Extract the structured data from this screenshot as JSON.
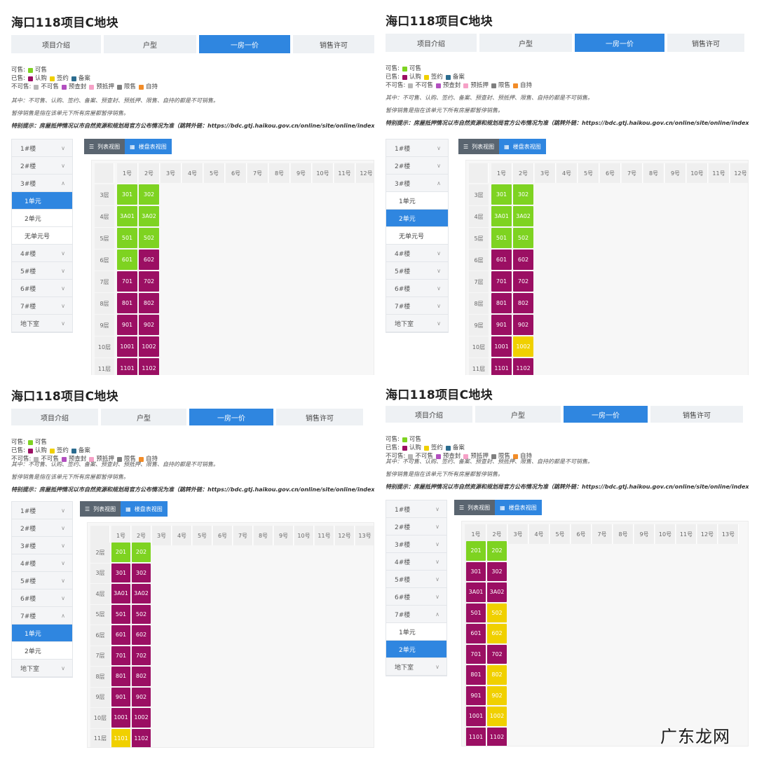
{
  "panels": [
    {
      "title": "海口118项目C地块",
      "tabs": [
        "项目介绍",
        "户型",
        "一房一价",
        "销售许可"
      ],
      "active_tab": 2,
      "legend": {
        "available_label": "可售:",
        "available_items": [
          "可售"
        ],
        "sold_label": "已售:",
        "sold_items": [
          "认购",
          "签约",
          "备案"
        ],
        "unavailable_label": "不可售:",
        "unavailable_items": [
          "不可售",
          "预查封",
          "预抵押",
          "限售",
          "自持"
        ]
      },
      "note1": "其中：不可售、认购、签约、备案、预查封、预抵押、限售、自持的都是不可销售。",
      "note2": "暂停销售是指在该单元下所有房屋都暂停销售。",
      "note3": "特别提示：房屋抵押情况以市自然资源和规划局官方公布情况为准（跳转外链：https://bdc.gtj.haikou.gov.cn/online/site/online/index.htm",
      "sidebar": [
        {
          "label": "1#楼",
          "type": "group",
          "chev": "∨"
        },
        {
          "label": "2#楼",
          "type": "group",
          "chev": "∨"
        },
        {
          "label": "3#楼",
          "type": "group",
          "chev": "∧"
        },
        {
          "label": "1单元",
          "type": "sub",
          "active": true
        },
        {
          "label": "2单元",
          "type": "sub",
          "active": false
        },
        {
          "label": "无单元号",
          "type": "sub",
          "active": false
        },
        {
          "label": "4#楼",
          "type": "group",
          "chev": "∨"
        },
        {
          "label": "5#楼",
          "type": "group",
          "chev": "∨"
        },
        {
          "label": "6#楼",
          "type": "group",
          "chev": "∨"
        },
        {
          "label": "7#楼",
          "type": "group",
          "chev": "∨"
        },
        {
          "label": "地下室",
          "type": "group",
          "chev": "∨"
        }
      ],
      "view_buttons": [
        "列表视图",
        "楼盘表视图"
      ],
      "columns": [
        "1号",
        "2号",
        "3号",
        "4号",
        "5号",
        "6号",
        "7号",
        "8号",
        "9号",
        "10号",
        "11号",
        "12号"
      ],
      "rows": [
        {
          "floor": "3层",
          "units": [
            [
              "301",
              "green"
            ],
            [
              "302",
              "green"
            ]
          ]
        },
        {
          "floor": "4层",
          "units": [
            [
              "3A01",
              "green"
            ],
            [
              "3A02",
              "green"
            ]
          ]
        },
        {
          "floor": "5层",
          "units": [
            [
              "501",
              "green"
            ],
            [
              "502",
              "green"
            ]
          ]
        },
        {
          "floor": "6层",
          "units": [
            [
              "601",
              "green"
            ],
            [
              "602",
              "purple"
            ]
          ]
        },
        {
          "floor": "7层",
          "units": [
            [
              "701",
              "purple"
            ],
            [
              "702",
              "purple"
            ]
          ]
        },
        {
          "floor": "8层",
          "units": [
            [
              "801",
              "purple"
            ],
            [
              "802",
              "purple"
            ]
          ]
        },
        {
          "floor": "9层",
          "units": [
            [
              "901",
              "purple"
            ],
            [
              "902",
              "purple"
            ]
          ]
        },
        {
          "floor": "10层",
          "units": [
            [
              "1001",
              "purple"
            ],
            [
              "1002",
              "purple"
            ]
          ]
        },
        {
          "floor": "11层",
          "units": [
            [
              "1101",
              "purple"
            ],
            [
              "1102",
              "purple"
            ]
          ]
        }
      ]
    },
    {
      "title": "海口118项目C地块",
      "tabs": [
        "项目介绍",
        "户型",
        "一房一价",
        "销售许可"
      ],
      "active_tab": 2,
      "legend": {
        "available_label": "可售:",
        "available_items": [
          "可售"
        ],
        "sold_label": "已售:",
        "sold_items": [
          "认购",
          "签约",
          "备案"
        ],
        "unavailable_label": "不可售:",
        "unavailable_items": [
          "不可售",
          "预查封",
          "预抵押",
          "限售",
          "自持"
        ]
      },
      "note1": "其中：不可售、认购、签约、备案、预查封、预抵押、限售、自持的都是不可销售。",
      "note2": "暂停销售是指在该单元下所有房屋都暂停销售。",
      "note3": "特别提示：房屋抵押情况以市自然资源和规划局官方公布情况为准（跳转外链：https://bdc.gtj.haikou.gov.cn/online/site/online/index.htm",
      "sidebar": [
        {
          "label": "1#楼",
          "type": "group",
          "chev": "∨"
        },
        {
          "label": "2#楼",
          "type": "group",
          "chev": "∨"
        },
        {
          "label": "3#楼",
          "type": "group",
          "chev": "∧"
        },
        {
          "label": "1单元",
          "type": "sub",
          "active": false
        },
        {
          "label": "2单元",
          "type": "sub",
          "active": true
        },
        {
          "label": "无单元号",
          "type": "sub",
          "active": false
        },
        {
          "label": "4#楼",
          "type": "group",
          "chev": "∨"
        },
        {
          "label": "5#楼",
          "type": "group",
          "chev": "∨"
        },
        {
          "label": "6#楼",
          "type": "group",
          "chev": "∨"
        },
        {
          "label": "7#楼",
          "type": "group",
          "chev": "∨"
        },
        {
          "label": "地下室",
          "type": "group",
          "chev": "∨"
        }
      ],
      "view_buttons": [
        "列表视图",
        "楼盘表视图"
      ],
      "columns": [
        "1号",
        "2号",
        "3号",
        "4号",
        "5号",
        "6号",
        "7号",
        "8号",
        "9号",
        "10号",
        "11号",
        "12号"
      ],
      "rows": [
        {
          "floor": "3层",
          "units": [
            [
              "301",
              "green"
            ],
            [
              "302",
              "green"
            ]
          ]
        },
        {
          "floor": "4层",
          "units": [
            [
              "3A01",
              "green"
            ],
            [
              "3A02",
              "green"
            ]
          ]
        },
        {
          "floor": "5层",
          "units": [
            [
              "501",
              "green"
            ],
            [
              "502",
              "green"
            ]
          ]
        },
        {
          "floor": "6层",
          "units": [
            [
              "601",
              "purple"
            ],
            [
              "602",
              "purple"
            ]
          ]
        },
        {
          "floor": "7层",
          "units": [
            [
              "701",
              "purple"
            ],
            [
              "702",
              "purple"
            ]
          ]
        },
        {
          "floor": "8层",
          "units": [
            [
              "801",
              "purple"
            ],
            [
              "802",
              "purple"
            ]
          ]
        },
        {
          "floor": "9层",
          "units": [
            [
              "901",
              "purple"
            ],
            [
              "902",
              "purple"
            ]
          ]
        },
        {
          "floor": "10层",
          "units": [
            [
              "1001",
              "purple"
            ],
            [
              "1002",
              "yellow"
            ]
          ]
        },
        {
          "floor": "11层",
          "units": [
            [
              "1101",
              "purple"
            ],
            [
              "1102",
              "purple"
            ]
          ]
        }
      ]
    },
    {
      "title": "海口118项目C地块",
      "tabs": [
        "项目介绍",
        "户型",
        "一房一价",
        "销售许可"
      ],
      "active_tab": 2,
      "legend": {
        "available_label": "可售:",
        "available_items": [
          "可售"
        ],
        "sold_label": "已售:",
        "sold_items": [
          "认购",
          "签约",
          "备案"
        ],
        "unavailable_label": "不可售:",
        "unavailable_items": [
          "不可售",
          "预查封",
          "预抵押",
          "限售",
          "自持"
        ]
      },
      "note1": "其中：不可售、认购、签约、备案、预查封、预抵押、限售、自持的都是不可销售。",
      "note2": "暂停销售是指在该单元下所有房屋都暂停销售。",
      "note3": "特别提示：房屋抵押情况以市自然资源和规划局官方公布情况为准（跳转外链：https://bdc.gtj.haikou.gov.cn/online/site/online/index.htm",
      "sidebar": [
        {
          "label": "1#楼",
          "type": "group",
          "chev": "∨"
        },
        {
          "label": "2#楼",
          "type": "group",
          "chev": "∨"
        },
        {
          "label": "3#楼",
          "type": "group",
          "chev": "∨"
        },
        {
          "label": "4#楼",
          "type": "group",
          "chev": "∨"
        },
        {
          "label": "5#楼",
          "type": "group",
          "chev": "∨"
        },
        {
          "label": "6#楼",
          "type": "group",
          "chev": "∨"
        },
        {
          "label": "7#楼",
          "type": "group",
          "chev": "∧"
        },
        {
          "label": "1单元",
          "type": "sub",
          "active": true
        },
        {
          "label": "2单元",
          "type": "sub",
          "active": false
        },
        {
          "label": "地下室",
          "type": "group",
          "chev": "∨"
        }
      ],
      "view_buttons": [
        "列表视图",
        "楼盘表视图"
      ],
      "columns": [
        "1号",
        "2号",
        "3号",
        "4号",
        "5号",
        "6号",
        "7号",
        "8号",
        "9号",
        "10号",
        "11号",
        "12号",
        "13号"
      ],
      "rows": [
        {
          "floor": "2层",
          "units": [
            [
              "201",
              "green"
            ],
            [
              "202",
              "green"
            ]
          ]
        },
        {
          "floor": "3层",
          "units": [
            [
              "301",
              "purple"
            ],
            [
              "302",
              "purple"
            ]
          ]
        },
        {
          "floor": "4层",
          "units": [
            [
              "3A01",
              "purple"
            ],
            [
              "3A02",
              "purple"
            ]
          ]
        },
        {
          "floor": "5层",
          "units": [
            [
              "501",
              "purple"
            ],
            [
              "502",
              "purple"
            ]
          ]
        },
        {
          "floor": "6层",
          "units": [
            [
              "601",
              "purple"
            ],
            [
              "602",
              "purple"
            ]
          ]
        },
        {
          "floor": "7层",
          "units": [
            [
              "701",
              "purple"
            ],
            [
              "702",
              "purple"
            ]
          ]
        },
        {
          "floor": "8层",
          "units": [
            [
              "801",
              "purple"
            ],
            [
              "802",
              "purple"
            ]
          ]
        },
        {
          "floor": "9层",
          "units": [
            [
              "901",
              "purple"
            ],
            [
              "902",
              "purple"
            ]
          ]
        },
        {
          "floor": "10层",
          "units": [
            [
              "1001",
              "purple"
            ],
            [
              "1002",
              "purple"
            ]
          ]
        },
        {
          "floor": "11层",
          "units": [
            [
              "1101",
              "yellow"
            ],
            [
              "1102",
              "purple"
            ]
          ]
        }
      ]
    },
    {
      "title": "海口118项目C地块",
      "tabs": [
        "项目介绍",
        "户型",
        "一房一价",
        "销售许可"
      ],
      "active_tab": 2,
      "legend": {
        "available_label": "可售:",
        "available_items": [
          "可售"
        ],
        "sold_label": "已售:",
        "sold_items": [
          "认购",
          "签约",
          "备案"
        ],
        "unavailable_label": "不可售:",
        "unavailable_items": [
          "不可售",
          "预查封",
          "预抵押",
          "限售",
          "自持"
        ]
      },
      "note1": "其中：不可售、认购、签约、备案、预查封、预抵押、限售、自持的都是不可销售。",
      "note2": "暂停销售是指在该单元下所有房屋都暂停销售。",
      "note3": "特别提示：房屋抵押情况以市自然资源和规划局官方公布情况为准（跳转外链：https://bdc.gtj.haikou.gov.cn/online/site/online/index.htm",
      "sidebar": [
        {
          "label": "1#楼",
          "type": "group",
          "chev": "∨"
        },
        {
          "label": "2#楼",
          "type": "group",
          "chev": "∨"
        },
        {
          "label": "3#楼",
          "type": "group",
          "chev": "∨"
        },
        {
          "label": "4#楼",
          "type": "group",
          "chev": "∨"
        },
        {
          "label": "5#楼",
          "type": "group",
          "chev": "∨"
        },
        {
          "label": "6#楼",
          "type": "group",
          "chev": "∨"
        },
        {
          "label": "7#楼",
          "type": "group",
          "chev": "∧"
        },
        {
          "label": "1单元",
          "type": "sub",
          "active": false
        },
        {
          "label": "2单元",
          "type": "sub",
          "active": true
        },
        {
          "label": "地下室",
          "type": "group",
          "chev": "∨"
        }
      ],
      "view_buttons": [
        "列表视图",
        "楼盘表视图"
      ],
      "columns": [
        "1号",
        "2号",
        "3号",
        "4号",
        "5号",
        "6号",
        "7号",
        "8号",
        "9号",
        "10号",
        "11号",
        "12号",
        "13号"
      ],
      "rows": [
        {
          "floor": "2层",
          "units": [
            [
              "201",
              "green"
            ],
            [
              "202",
              "green"
            ]
          ]
        },
        {
          "floor": "3层",
          "units": [
            [
              "301",
              "purple"
            ],
            [
              "302",
              "purple"
            ]
          ]
        },
        {
          "floor": "4层",
          "units": [
            [
              "3A01",
              "purple"
            ],
            [
              "3A02",
              "purple"
            ]
          ]
        },
        {
          "floor": "5层",
          "units": [
            [
              "501",
              "purple"
            ],
            [
              "502",
              "yellow"
            ]
          ]
        },
        {
          "floor": "6层",
          "units": [
            [
              "601",
              "purple"
            ],
            [
              "602",
              "yellow"
            ]
          ]
        },
        {
          "floor": "7层",
          "units": [
            [
              "701",
              "purple"
            ],
            [
              "702",
              "purple"
            ]
          ]
        },
        {
          "floor": "8层",
          "units": [
            [
              "801",
              "purple"
            ],
            [
              "802",
              "yellow"
            ]
          ]
        },
        {
          "floor": "9层",
          "units": [
            [
              "901",
              "purple"
            ],
            [
              "902",
              "yellow"
            ]
          ]
        },
        {
          "floor": "10层",
          "units": [
            [
              "1001",
              "purple"
            ],
            [
              "1002",
              "yellow"
            ]
          ]
        },
        {
          "floor": "11层",
          "units": [
            [
              "1101",
              "purple"
            ],
            [
              "1102",
              "purple"
            ]
          ]
        }
      ]
    }
  ],
  "watermark": "广东龙网",
  "colors": {
    "available": "#7ed321",
    "subscribed": "#9b0f63",
    "signed": "#f0d000",
    "filed": "#2b6c8f",
    "accent": "#2f86e0"
  }
}
